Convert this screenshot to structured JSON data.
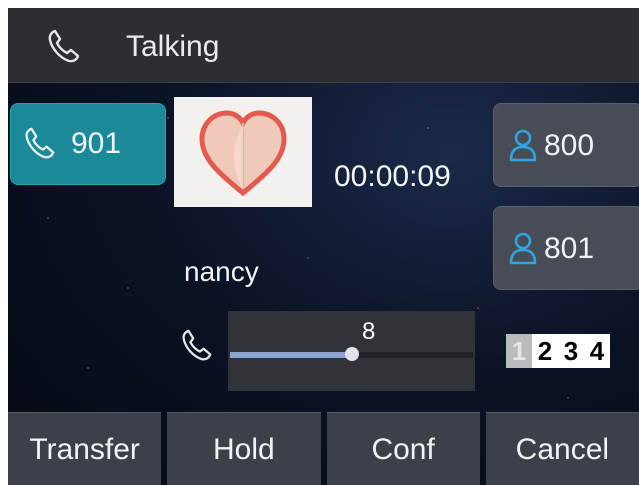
{
  "header": {
    "status": "Talking",
    "icon": "phone-handset-icon"
  },
  "active_line": {
    "number": "901",
    "icon": "phone-handset-icon",
    "color": "#1b8a98"
  },
  "call": {
    "duration": "00:00:09",
    "contact_name": "nancy",
    "avatar": "heart-avatar-icon"
  },
  "contacts": [
    {
      "number": "800",
      "icon": "person-icon"
    },
    {
      "number": "801",
      "icon": "person-icon"
    }
  ],
  "volume": {
    "value": "8",
    "level_fraction": 0.5,
    "icon": "phone-handset-icon"
  },
  "pages": [
    "1",
    "2",
    "3",
    "4"
  ],
  "active_page": "1",
  "softkeys": {
    "transfer": "Transfer",
    "hold": "Hold",
    "conf": "Conf",
    "cancel": "Cancel"
  }
}
